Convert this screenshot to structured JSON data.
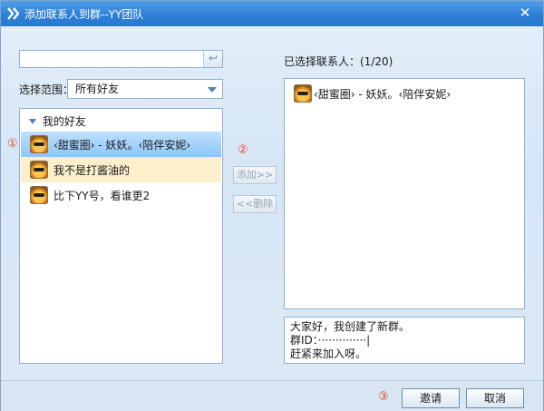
{
  "window": {
    "title": "添加联系人到群--YY团队",
    "close": "✕"
  },
  "search": {
    "placeholder": "",
    "enter_icon": "↩"
  },
  "range": {
    "label": "选择范围：",
    "value": "所有好友"
  },
  "left": {
    "group": "我的好友",
    "friends": [
      {
        "name": "‹甜蜜圈›        - 妖妖。‹陪伴安妮›",
        "state": "selected"
      },
      {
        "name": "我不是打酱油的",
        "state": "hover"
      },
      {
        "name": "比下YY号，看谁更2",
        "state": "normal"
      }
    ]
  },
  "buttons": {
    "add": "添加>>",
    "remove": "<<删除",
    "invite": "邀请",
    "cancel": "取消"
  },
  "right": {
    "label": "已选择联系人：(1/20)",
    "selected": [
      "‹甜蜜圈›        - 妖妖。‹陪伴安妮›"
    ],
    "message_lines": [
      "大家好，我创建了新群。",
      "群ID：··············|",
      "赶紧来加入呀。"
    ]
  },
  "steps": [
    "①",
    "②",
    "③"
  ],
  "colors": {
    "title": "#2c7ed6",
    "selected": "#8ec6f6",
    "hover": "#fbefcc",
    "step_number": "#e2472d"
  }
}
